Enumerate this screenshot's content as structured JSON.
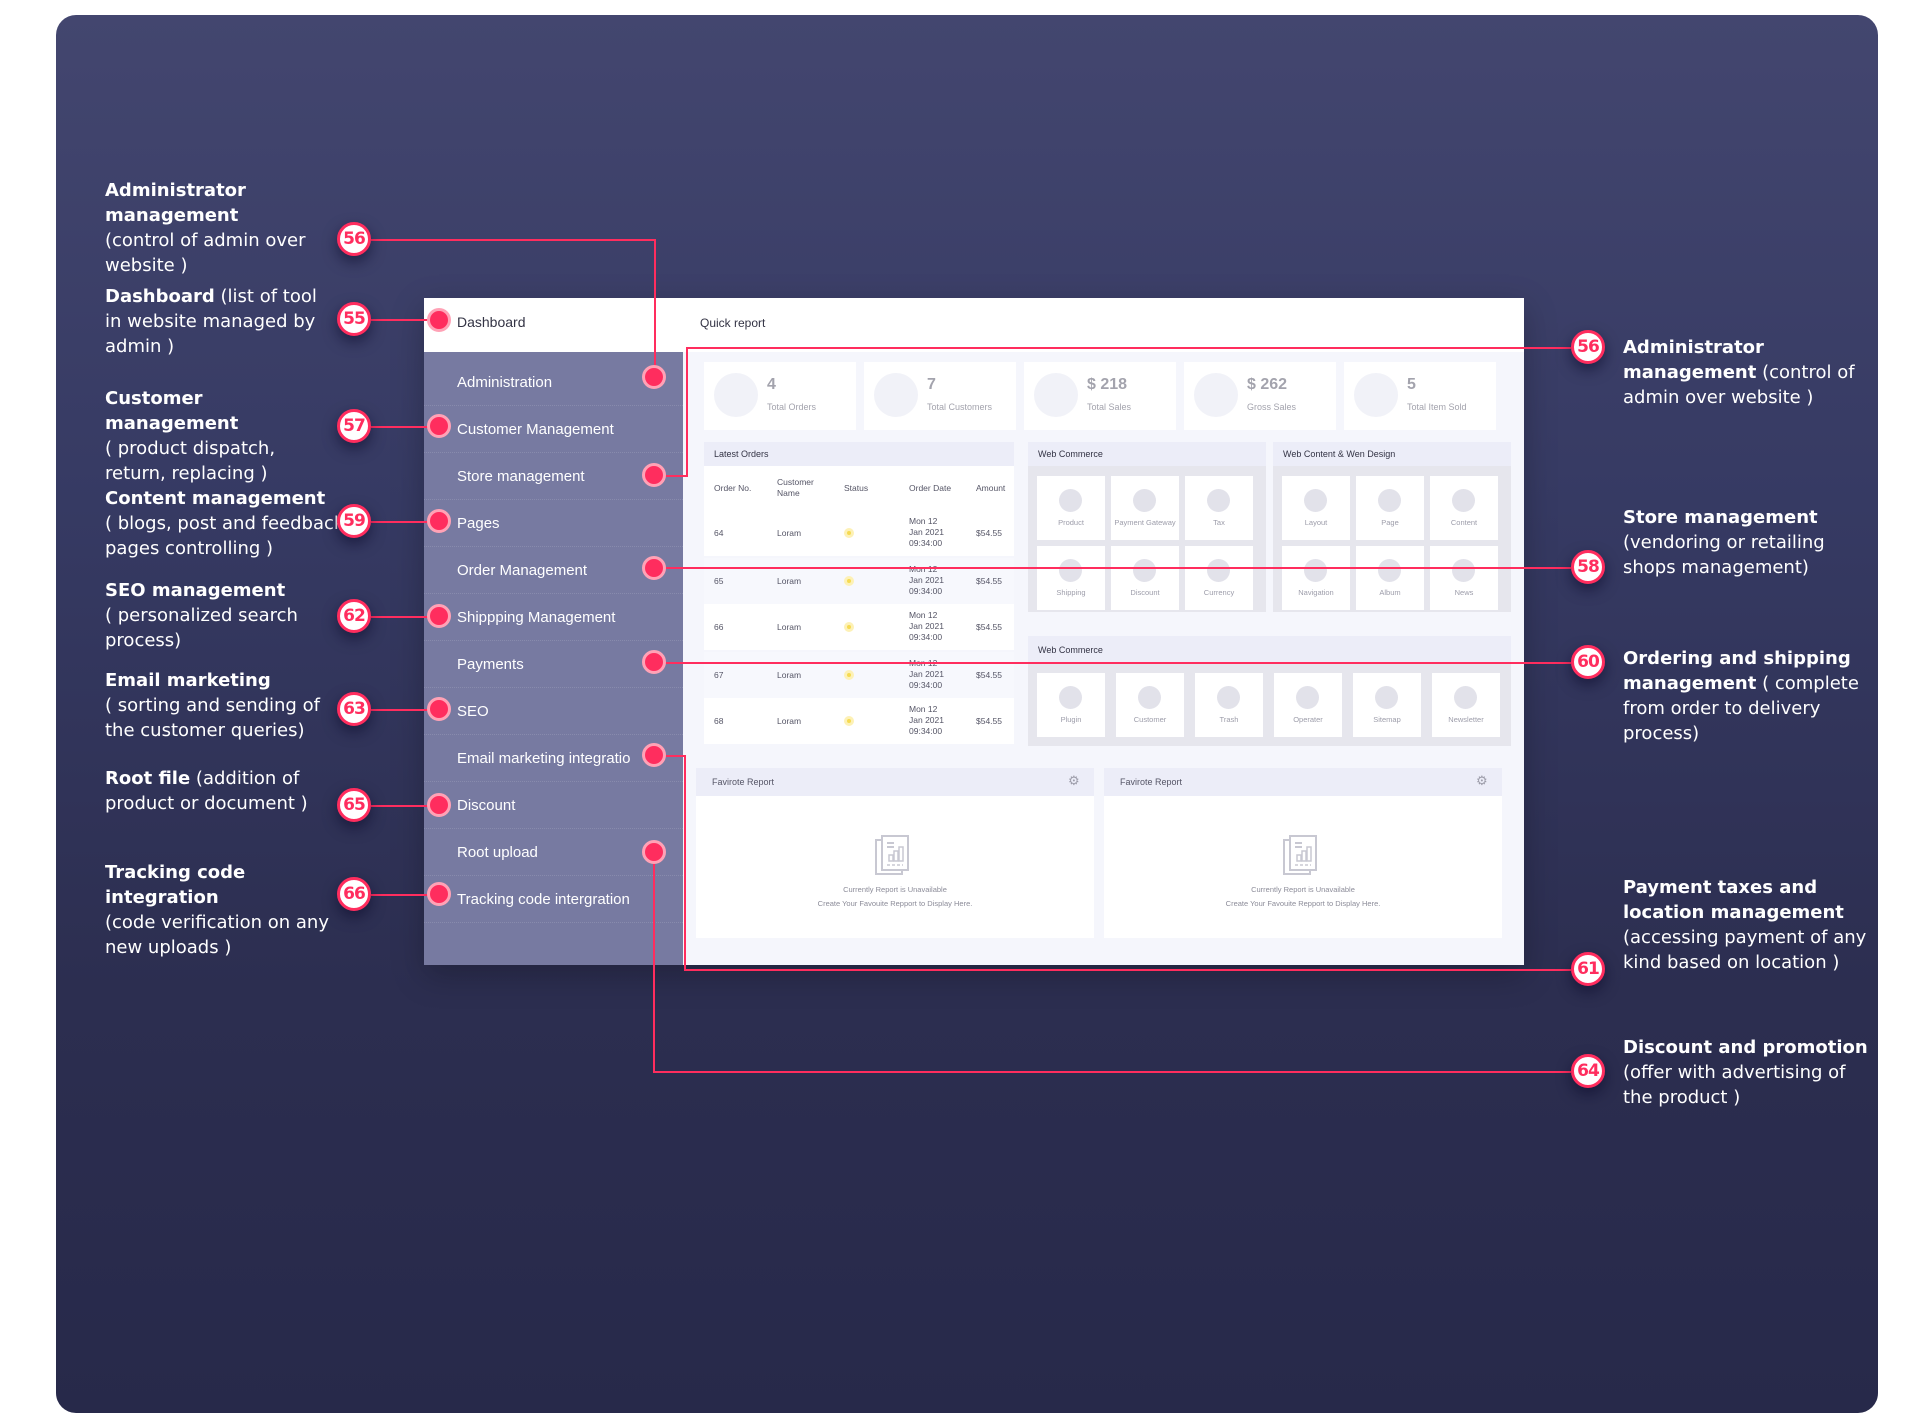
{
  "colors": {
    "accent": "#ff2d5e",
    "sidebar": "#777aa1",
    "background_top": "#43466f",
    "background_bottom": "#27294a"
  },
  "sidebar": {
    "header": "Dashboard",
    "items": [
      {
        "label": "Administration"
      },
      {
        "label": "Customer Management"
      },
      {
        "label": "Store management"
      },
      {
        "label": "Pages"
      },
      {
        "label": "Order Management"
      },
      {
        "label": "Shippping Management"
      },
      {
        "label": "Payments"
      },
      {
        "label": "SEO"
      },
      {
        "label": "Email marketing integratio"
      },
      {
        "label": "Discount"
      },
      {
        "label": "Root upload"
      },
      {
        "label": "Tracking code intergration"
      }
    ]
  },
  "topbar": {
    "title": "Quick report"
  },
  "stats": [
    {
      "value": "4",
      "label": "Total Orders"
    },
    {
      "value": "7",
      "label": "Total Customers"
    },
    {
      "value": "$ 218",
      "label": "Total Sales"
    },
    {
      "value": "$ 262",
      "label": "Gross Sales"
    },
    {
      "value": "5",
      "label": "Total Item Sold"
    }
  ],
  "latest_orders": {
    "title": "Latest Orders",
    "columns": [
      "Order No.",
      "Customer Name",
      "Status",
      "Order Date",
      "Amount"
    ],
    "rows": [
      {
        "order_no": "64",
        "customer": "Loram",
        "status": "pending",
        "date_line1": "Mon 12",
        "date_line2": "Jan 2021",
        "date_line3": "09:34:00",
        "amount": "$54.55"
      },
      {
        "order_no": "65",
        "customer": "Loram",
        "status": "pending",
        "date_line1": "Mon 12",
        "date_line2": "Jan 2021",
        "date_line3": "09:34:00",
        "amount": "$54.55"
      },
      {
        "order_no": "66",
        "customer": "Loram",
        "status": "pending",
        "date_line1": "Mon 12",
        "date_line2": "Jan 2021",
        "date_line3": "09:34:00",
        "amount": "$54.55"
      },
      {
        "order_no": "67",
        "customer": "Loram",
        "status": "pending",
        "date_line1": "Mon 12",
        "date_line2": "Jan 2021",
        "date_line3": "09:34:00",
        "amount": "$54.55"
      },
      {
        "order_no": "68",
        "customer": "Loram",
        "status": "pending",
        "date_line1": "Mon 12",
        "date_line2": "Jan 2021",
        "date_line3": "09:34:00",
        "amount": "$54.55"
      }
    ]
  },
  "web_commerce": {
    "title": "Web Commerce",
    "tiles": [
      "Product",
      "Payment Gateway",
      "Tax",
      "Shipping",
      "Discount",
      "Currency"
    ]
  },
  "web_content": {
    "title": "Web Content & Wen Design",
    "tiles": [
      "Layout",
      "Page",
      "Content",
      "Navigation",
      "Album",
      "News"
    ]
  },
  "web_commerce_2": {
    "title": "Web Commerce",
    "tiles": [
      "Plugin",
      "Customer",
      "Trash",
      "Operater",
      "Sitemap",
      "Newsletter"
    ]
  },
  "reports": [
    {
      "title": "Favirote Report",
      "line1": "Currently Report is Unavailable",
      "line2": "Create Your Favouite Repport to Display Here."
    },
    {
      "title": "Favirote Report",
      "line1": "Currently Report is Unavailable",
      "line2": "Create Your Favouite Repport to Display Here."
    }
  ],
  "annotations_left": [
    {
      "number": "56",
      "title": "Administrator management",
      "desc": "(control of admin over website )"
    },
    {
      "number": "55",
      "title": "Dashboard",
      "desc": "(list of tool in website managed by admin )"
    },
    {
      "number": "57",
      "title": "Customer management",
      "desc": "( product dispatch, return, replacing )"
    },
    {
      "number": "59",
      "title": "Content management",
      "desc": "( blogs, post and feedback pages controlling )"
    },
    {
      "number": "62",
      "title": "SEO management",
      "desc": "( personalized search process)"
    },
    {
      "number": "63",
      "title": "Email marketing",
      "desc": "( sorting and sending of the customer queries)"
    },
    {
      "number": "65",
      "title": "Root file",
      "desc": "(addition of product or document )"
    },
    {
      "number": "66",
      "title": "Tracking code integration",
      "desc": "(code verification on any new uploads )"
    }
  ],
  "annotations_right": [
    {
      "number": "56",
      "title": "Administrator management",
      "desc": "(control of admin over website )"
    },
    {
      "number": "58",
      "title": "Store management",
      "desc": "(vendoring or retailing shops management)"
    },
    {
      "number": "60",
      "title": "Ordering and shipping management",
      "desc": "( complete from order to delivery process)"
    },
    {
      "number": "61",
      "title": "Payment taxes and location management",
      "desc": "(accessing payment of any kind based on location )"
    },
    {
      "number": "64",
      "title": "Discount and promotion",
      "desc": "(offer with advertising of the product )"
    }
  ]
}
